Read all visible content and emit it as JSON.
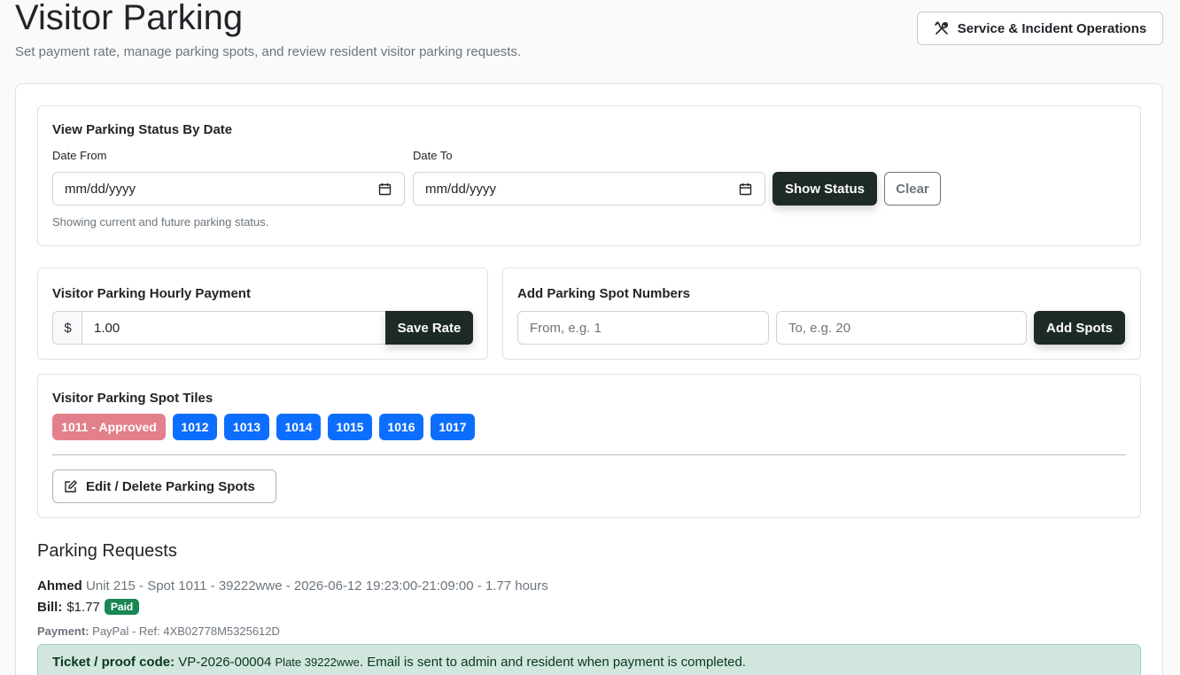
{
  "header": {
    "title": "Visitor Parking",
    "subtitle": "Set payment rate, manage parking spots, and review resident visitor parking requests.",
    "service_button": "Service & Incident Operations"
  },
  "status_by_date": {
    "title": "View Parking Status By Date",
    "date_from_label": "Date From",
    "date_from_placeholder": "mm/dd/yyyy",
    "date_to_label": "Date To",
    "date_to_placeholder": "mm/dd/yyyy",
    "show_button": "Show Status",
    "clear_button": "Clear",
    "hint": "Showing current and future parking status."
  },
  "hourly_payment": {
    "title": "Visitor Parking Hourly Payment",
    "currency_prefix": "$",
    "rate_value": "1.00",
    "save_button": "Save Rate"
  },
  "add_spots": {
    "title": "Add Parking Spot Numbers",
    "from_placeholder": "From, e.g. 1",
    "to_placeholder": "To, e.g. 20",
    "add_button": "Add Spots"
  },
  "spot_tiles": {
    "title": "Visitor Parking Spot Tiles",
    "tiles": [
      {
        "label": "1011 - Approved",
        "status": "approved"
      },
      {
        "label": "1012",
        "status": "available"
      },
      {
        "label": "1013",
        "status": "available"
      },
      {
        "label": "1014",
        "status": "available"
      },
      {
        "label": "1015",
        "status": "available"
      },
      {
        "label": "1016",
        "status": "available"
      },
      {
        "label": "1017",
        "status": "available"
      }
    ],
    "edit_button": "Edit / Delete Parking Spots"
  },
  "requests": {
    "title": "Parking Requests",
    "items": [
      {
        "name": "Ahmed",
        "details": "Unit 215 - Spot 1011 - 39222wwe - 2026-06-12 19:23:00-21:09:00 - 1.77 hours",
        "bill_label": "Bill:",
        "bill_amount": "$1.77",
        "bill_status": "Paid",
        "payment_label": "Payment:",
        "payment_details": "PayPal - Ref: 4XB02778M5325612D",
        "ticket_label": "Ticket / proof code:",
        "ticket_code": "VP-2026-00004",
        "ticket_plate": "Plate 39222wwe",
        "ticket_note": ". Email is sent to admin and resident when payment is completed."
      }
    ]
  },
  "colors": {
    "primary_dark": "#1e2a28",
    "tile_blue": "#0d6efd",
    "tile_approved": "#e4808b",
    "paid_green": "#198754",
    "ticket_bg": "#d1e7dd"
  },
  "icons": {
    "service": "tools-icon",
    "calendar": "calendar-icon",
    "edit": "pencil-square-icon"
  }
}
